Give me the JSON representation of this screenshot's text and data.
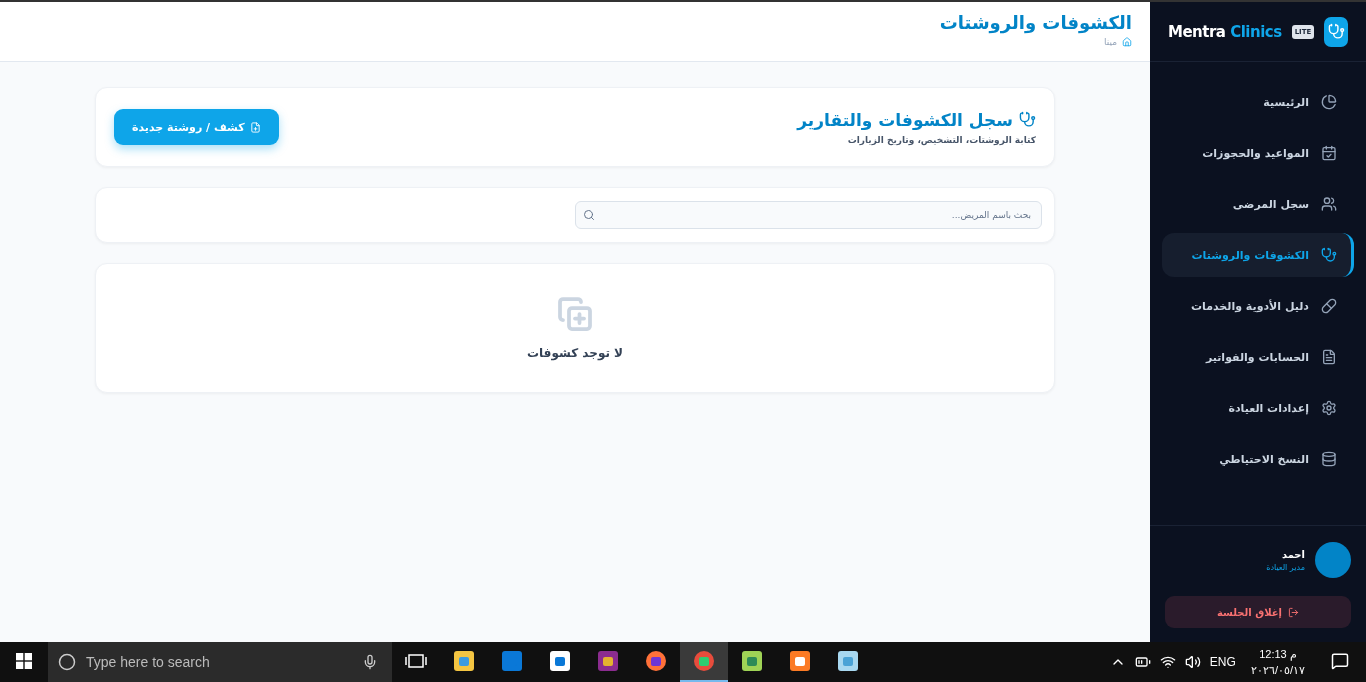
{
  "sidebar": {
    "brand": {
      "name": "Mentra",
      "accent": "Clinics",
      "badge": "LITE"
    },
    "items": [
      {
        "label": "الرئيسية",
        "selected": false
      },
      {
        "label": "المواعيد والحجوزات",
        "selected": false
      },
      {
        "label": "سجل المرضى",
        "selected": false
      },
      {
        "label": "الكشوفات والروشتات",
        "selected": true
      },
      {
        "label": "دليل الأدوية والخدمات",
        "selected": false
      },
      {
        "label": "الحسابات والفواتير",
        "selected": false
      },
      {
        "label": "إعدادات العيادة",
        "selected": false
      },
      {
        "label": "النسخ الاحتياطي",
        "selected": false
      }
    ],
    "user": {
      "name": "احمد",
      "role": "مدير العيادة"
    },
    "logout": "إغلاق الجلسة"
  },
  "header": {
    "title": "الكشوفات والروشتات",
    "breadcrumb": "مينا"
  },
  "section": {
    "title": "سجل الكشوفات والتقارير",
    "subtitle": "كتابة الروشتات، التشخيص، وتاريخ الزيارات",
    "new_button": "كشف / روشتة جديدة"
  },
  "search": {
    "placeholder": "بحث باسم المريض..."
  },
  "empty": {
    "message": "لا توجد كشوفات"
  },
  "taskbar": {
    "search_placeholder": "Type here to search",
    "apps": [
      {
        "selected": false
      },
      {
        "selected": false
      },
      {
        "selected": false
      },
      {
        "selected": false
      },
      {
        "selected": false
      },
      {
        "selected": true
      },
      {
        "selected": false
      },
      {
        "selected": false
      },
      {
        "selected": false
      }
    ],
    "language": "ENG",
    "time": "م 12:13",
    "date": "٢٠٢٦/٠٥/١٧"
  }
}
